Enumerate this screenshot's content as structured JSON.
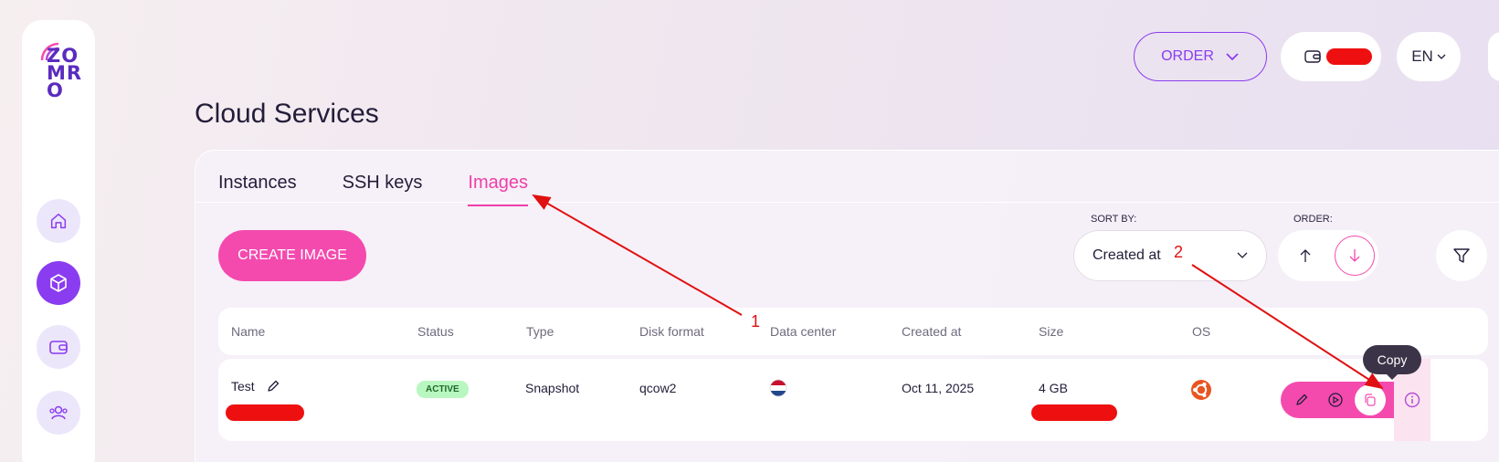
{
  "logo": {
    "text_lines": [
      "ZO",
      "MR",
      "O"
    ]
  },
  "sidebar": {
    "items": [
      {
        "name": "home",
        "icon": "home-icon",
        "active": false
      },
      {
        "name": "cloud",
        "icon": "cube-icon",
        "active": true
      },
      {
        "name": "wallet",
        "icon": "wallet-icon",
        "active": false
      },
      {
        "name": "users",
        "icon": "users-icon",
        "active": false
      }
    ]
  },
  "header": {
    "order_label": "ORDER",
    "language": "EN"
  },
  "page": {
    "title": "Cloud Services"
  },
  "tabs": [
    {
      "label": "Instances",
      "active": false
    },
    {
      "label": "SSH keys",
      "active": false
    },
    {
      "label": "Images",
      "active": true
    }
  ],
  "toolbar": {
    "create_label": "CREATE IMAGE",
    "sort_by_label": "SORT BY:",
    "sort_value": "Created at",
    "order_label": "ORDER:"
  },
  "table": {
    "columns": [
      "Name",
      "Status",
      "Type",
      "Disk format",
      "Data center",
      "Created at",
      "Size",
      "OS"
    ],
    "rows": [
      {
        "name": "Test",
        "status": "ACTIVE",
        "type": "Snapshot",
        "disk_format": "qcow2",
        "data_center_flag": "netherlands-flag",
        "created_at": "Oct 11, 2025",
        "size": "4 GB",
        "os_icon": "ubuntu-icon"
      }
    ]
  },
  "tooltip": {
    "text": "Copy"
  },
  "annotations": {
    "label_1": "1",
    "label_2": "2"
  },
  "colors": {
    "accent": "#f44aae",
    "purple": "#8a3cf0",
    "annotation": "#e01010"
  }
}
